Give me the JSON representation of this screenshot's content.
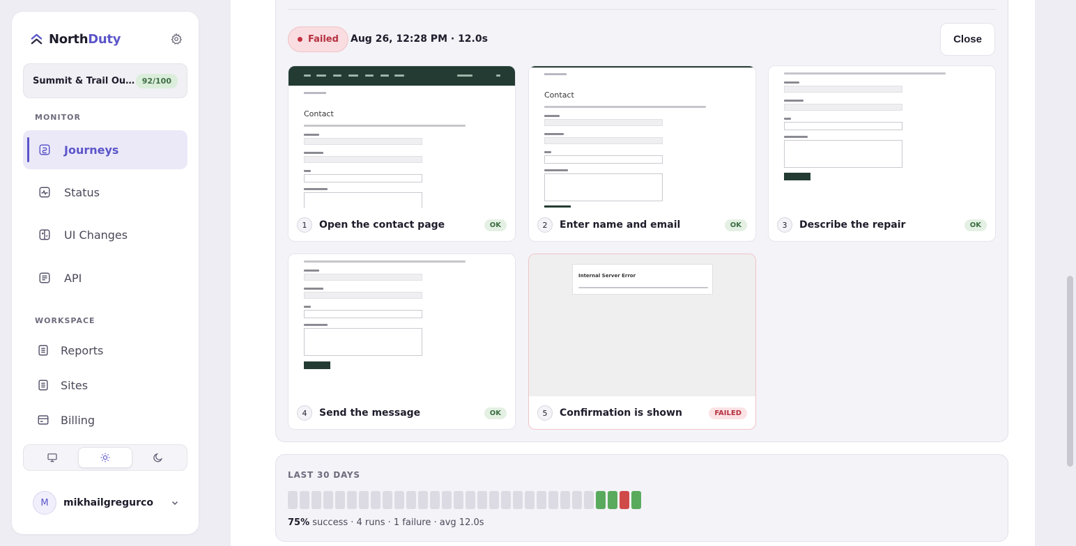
{
  "brand": {
    "name_part1": "North",
    "name_part2": "Duty"
  },
  "site": {
    "name": "Summit & Trail Outfi...",
    "quota": "92/100"
  },
  "sidebar": {
    "monitor_label": "MONITOR",
    "monitor_items": [
      {
        "label": "Journeys",
        "icon": "route-icon",
        "active": true
      },
      {
        "label": "Status",
        "icon": "pulse-icon"
      },
      {
        "label": "UI Changes",
        "icon": "diff-icon"
      },
      {
        "label": "API",
        "icon": "code-icon"
      }
    ],
    "workspace_label": "WORKSPACE",
    "workspace_items": [
      {
        "label": "Reports",
        "icon": "document-icon"
      },
      {
        "label": "Sites",
        "icon": "document-icon"
      },
      {
        "label": "Billing",
        "icon": "card-icon"
      }
    ],
    "theme": {
      "options": [
        "system",
        "light",
        "dark"
      ],
      "selected": "light"
    },
    "user": {
      "initial": "M",
      "name": "mikhailgregurco"
    }
  },
  "run": {
    "status": "Failed",
    "meta": "Aug 26, 12:28 PM · 12.0s",
    "close_label": "Close",
    "steps": [
      {
        "num": "1",
        "label": "Open the contact page",
        "status": "OK"
      },
      {
        "num": "2",
        "label": "Enter name and email",
        "status": "OK"
      },
      {
        "num": "3",
        "label": "Describe the repair",
        "status": "OK"
      },
      {
        "num": "4",
        "label": "Send the message",
        "status": "OK"
      },
      {
        "num": "5",
        "label": "Confirmation is shown",
        "status": "FAILED"
      }
    ],
    "thumb_text": {
      "contact_title": "Contact",
      "error_title": "Internal Server Error"
    }
  },
  "history": {
    "title": "LAST 30 DAYS",
    "days": [
      "none",
      "none",
      "none",
      "none",
      "none",
      "none",
      "none",
      "none",
      "none",
      "none",
      "none",
      "none",
      "none",
      "none",
      "none",
      "none",
      "none",
      "none",
      "none",
      "none",
      "none",
      "none",
      "none",
      "none",
      "none",
      "none",
      "ok",
      "ok",
      "fail",
      "ok"
    ],
    "success_pct": "75%",
    "summary_rest": " success · 4 runs · 1 failure · avg 12.0s"
  },
  "colors": {
    "accent": "#5b55c9",
    "ok": "#5aaa5e",
    "fail": "#d04a4a",
    "failed_badge_bg": "#f9dde0"
  }
}
